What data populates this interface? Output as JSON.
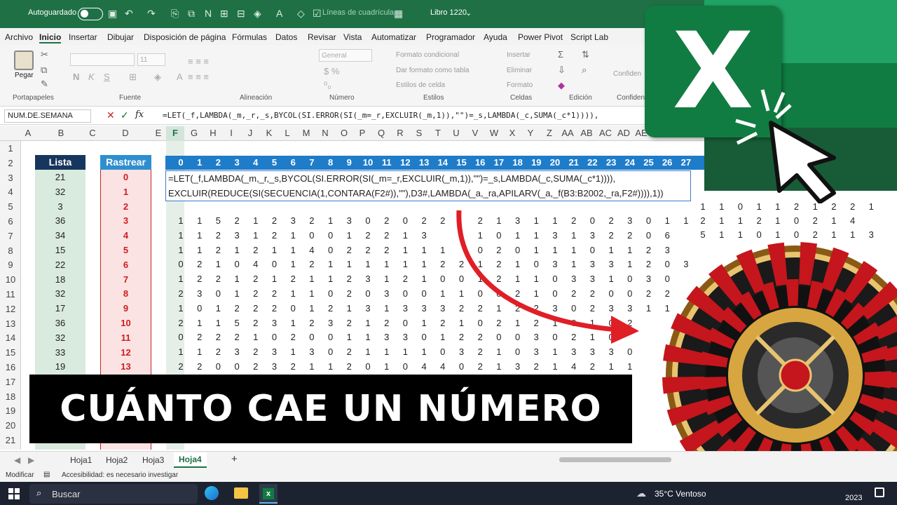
{
  "titlebar": {
    "autosave": "Autoguardado",
    "gridlines": "Líneas de cuadrícula",
    "book": "Libro 1220"
  },
  "menu": [
    "Archivo",
    "Inicio",
    "Insertar",
    "Dibujar",
    "Disposición de página",
    "Fórmulas",
    "Datos",
    "Revisar",
    "Vista",
    "Automatizar",
    "Programador",
    "Ayuda",
    "Power Pivot",
    "Script Lab"
  ],
  "ribbon": {
    "paste": "Pegar",
    "font_size": "11",
    "number_format": "General",
    "cond_format": "Formato condicional",
    "table_format": "Dar formato como tabla",
    "cell_styles": "Estilos de celda",
    "insert": "Insertar",
    "delete": "Eliminar",
    "format": "Formato",
    "groups": [
      "Portapapeles",
      "Fuente",
      "Alineación",
      "Número",
      "Estilos",
      "Celdas",
      "Edición",
      "Confidencia"
    ],
    "confidential": "Confiden"
  },
  "formula_bar": {
    "name_box": "NUM.DE.SEMANA",
    "formula": "=LET(_f,LAMBDA(_m,_r,_s,BYCOL(SI.ERROR(SI(_m=_r,EXCLUIR(_m,1)),\"\")=_s,LAMBDA(_c,SUMA(_c*1)))),"
  },
  "columns": [
    "A",
    "B",
    "C",
    "D",
    "E",
    "F",
    "G",
    "H",
    "I",
    "J",
    "K",
    "L",
    "M",
    "N",
    "O",
    "P",
    "Q",
    "R",
    "S",
    "T",
    "U",
    "V",
    "W",
    "X",
    "Y",
    "Z",
    "AA",
    "AB",
    "AC",
    "AD",
    "AE"
  ],
  "rows": [
    "1",
    "2",
    "3",
    "4",
    "5",
    "6",
    "7",
    "8",
    "9",
    "10",
    "11",
    "12",
    "13",
    "14",
    "15",
    "16",
    "17",
    "18",
    "19",
    "20",
    "21"
  ],
  "lista": {
    "header": "Lista",
    "values": [
      "21",
      "32",
      "3",
      "36",
      "34",
      "15",
      "22",
      "18",
      "32",
      "17",
      "36",
      "32",
      "33",
      "19"
    ]
  },
  "rastrear": {
    "header": "Rastrear",
    "values": [
      "0",
      "1",
      "2",
      "3",
      "4",
      "5",
      "6",
      "7",
      "8",
      "9",
      "10",
      "11",
      "12",
      "13"
    ]
  },
  "header_numbers": [
    "0",
    "1",
    "2",
    "3",
    "4",
    "5",
    "6",
    "7",
    "8",
    "9",
    "10",
    "11",
    "12",
    "13",
    "14",
    "15",
    "16",
    "17",
    "18",
    "19",
    "20",
    "21",
    "22",
    "23",
    "24",
    "25",
    "26",
    "27"
  ],
  "let_line1": "=LET(_f,LAMBDA(_m,_r,_s,BYCOL(SI.ERROR(SI(_m=_r,EXCLUIR(_m,1)),\"\")=_s,LAMBDA(_c,SUMA(_c*1)))),",
  "let_line2": "EXCLUIR(REDUCE(SI(SECUENCIA(1,CONTARA(F2#)),\"\"),D3#,LAMBDA(_a,_ra,APILARV(_a,_f(B3:B2002,_ra,F2#)))),1))",
  "grid": [
    [
      "1",
      "1",
      "5",
      "2",
      "1",
      "2",
      "3",
      "2",
      "1",
      "3",
      "0",
      "2",
      "0",
      "2",
      "2",
      "",
      "2",
      "1",
      "3",
      "1",
      "1",
      "2",
      "0",
      "2",
      "3",
      "0",
      "1",
      "1"
    ],
    [
      "1",
      "1",
      "2",
      "3",
      "1",
      "2",
      "1",
      "0",
      "0",
      "1",
      "2",
      "2",
      "1",
      "3",
      "",
      "1",
      "1",
      "0",
      "1",
      "1",
      "3",
      "1",
      "3",
      "2",
      "2",
      "0",
      "6",
      ""
    ],
    [
      "1",
      "1",
      "2",
      "1",
      "2",
      "1",
      "1",
      "4",
      "0",
      "2",
      "2",
      "2",
      "1",
      "1",
      "1",
      "",
      "0",
      "2",
      "0",
      "1",
      "1",
      "1",
      "0",
      "1",
      "1",
      "2",
      "3",
      ""
    ],
    [
      "0",
      "2",
      "1",
      "0",
      "4",
      "0",
      "1",
      "2",
      "1",
      "1",
      "1",
      "1",
      "1",
      "1",
      "2",
      "2",
      "1",
      "2",
      "1",
      "0",
      "3",
      "1",
      "3",
      "3",
      "1",
      "2",
      "0",
      "3"
    ],
    [
      "1",
      "2",
      "2",
      "1",
      "2",
      "1",
      "2",
      "1",
      "1",
      "2",
      "3",
      "1",
      "2",
      "1",
      "0",
      "0",
      "1",
      "2",
      "1",
      "1",
      "0",
      "3",
      "3",
      "1",
      "0",
      "3",
      "0",
      ""
    ],
    [
      "2",
      "3",
      "0",
      "1",
      "2",
      "2",
      "1",
      "1",
      "0",
      "2",
      "0",
      "3",
      "0",
      "0",
      "1",
      "1",
      "0",
      "0",
      "2",
      "1",
      "0",
      "2",
      "2",
      "0",
      "0",
      "2",
      "2",
      ""
    ],
    [
      "1",
      "0",
      "1",
      "2",
      "2",
      "2",
      "0",
      "1",
      "2",
      "1",
      "3",
      "1",
      "3",
      "3",
      "3",
      "2",
      "2",
      "1",
      "2",
      "2",
      "3",
      "0",
      "2",
      "3",
      "3",
      "1",
      "1",
      ""
    ],
    [
      "2",
      "1",
      "1",
      "5",
      "2",
      "3",
      "1",
      "2",
      "3",
      "2",
      "1",
      "2",
      "0",
      "1",
      "2",
      "1",
      "0",
      "2",
      "1",
      "2",
      "1",
      "0",
      "1",
      "0",
      "2",
      "",
      ""
    ],
    [
      "0",
      "2",
      "2",
      "2",
      "1",
      "0",
      "2",
      "0",
      "0",
      "1",
      "1",
      "3",
      "3",
      "0",
      "1",
      "2",
      "2",
      "0",
      "0",
      "3",
      "0",
      "2",
      "1",
      "0",
      "",
      "",
      ""
    ],
    [
      "1",
      "1",
      "2",
      "3",
      "2",
      "3",
      "1",
      "3",
      "0",
      "2",
      "1",
      "1",
      "1",
      "1",
      "0",
      "3",
      "2",
      "1",
      "0",
      "3",
      "1",
      "3",
      "3",
      "3",
      "0",
      "",
      ""
    ],
    [
      "2",
      "2",
      "0",
      "0",
      "2",
      "3",
      "2",
      "1",
      "1",
      "2",
      "0",
      "1",
      "0",
      "4",
      "4",
      "0",
      "2",
      "1",
      "3",
      "2",
      "1",
      "4",
      "2",
      "1",
      "1",
      "",
      ""
    ]
  ],
  "right_numbers": {
    "r5": [
      "1",
      "1",
      "0",
      "1",
      "1",
      "2",
      "1",
      "2",
      "2",
      "1"
    ],
    "r6": [
      "2",
      "1",
      "1",
      "2",
      "1",
      "0",
      "2",
      "1",
      "4"
    ],
    "r7": [
      "5",
      "1",
      "1",
      "0",
      "1",
      "0",
      "2",
      "1",
      "1",
      "3"
    ]
  },
  "banner": "CUÁNTO CAE UN NÚMERO",
  "sheets": [
    "Hoja1",
    "Hoja2",
    "Hoja3",
    "Hoja4"
  ],
  "status": {
    "mode": "Modificar",
    "access": "Accesibilidad: es necesario investigar"
  },
  "taskbar": {
    "search": "Buscar",
    "weather": "35°C Ventoso",
    "date": "2023"
  },
  "colors": {
    "excel_green": "#1f7145",
    "lista_header": "#17365d",
    "rastrear_header": "#2f8fce",
    "rastrear_text": "#d01c1c",
    "roulette_red": "#c4161c",
    "roulette_green": "#1f8a3d"
  }
}
